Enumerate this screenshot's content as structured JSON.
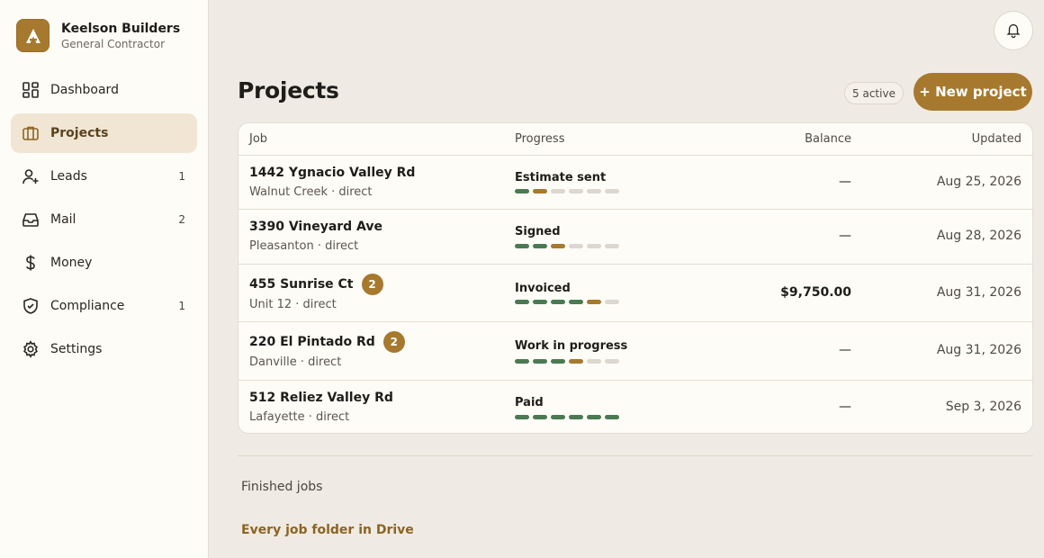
{
  "brand": {
    "name": "Keelson Builders",
    "subtitle": "General Contractor",
    "logo_letter": "A"
  },
  "nav": [
    {
      "label": "Dashboard",
      "icon": "dashboard-icon",
      "count": ""
    },
    {
      "label": "Projects",
      "icon": "briefcase-icon",
      "count": "",
      "active": true
    },
    {
      "label": "Leads",
      "icon": "user-plus-icon",
      "count": "1"
    },
    {
      "label": "Mail",
      "icon": "inbox-icon",
      "count": "2"
    },
    {
      "label": "Money",
      "icon": "dollar-icon",
      "count": ""
    },
    {
      "label": "Compliance",
      "icon": "shield-check-icon",
      "count": "1"
    },
    {
      "label": "Settings",
      "icon": "gear-icon",
      "count": ""
    }
  ],
  "header": {
    "notifications_icon": "bell-icon"
  },
  "page": {
    "title": "Projects",
    "active_label": "5 active",
    "new_button": "+ New project"
  },
  "table": {
    "columns": {
      "job": "Job",
      "progress": "Progress",
      "balance": "Balance",
      "updated": "Updated"
    },
    "progress_steps": 6,
    "rows": [
      {
        "job": "1442 Ygnacio Valley Rd",
        "location": "Walnut Creek · direct",
        "badge": "",
        "status": "Estimate sent",
        "steps_done": 1,
        "balance": "—",
        "updated": "Aug 25, 2026"
      },
      {
        "job": "3390 Vineyard Ave",
        "location": "Pleasanton · direct",
        "badge": "",
        "status": "Signed",
        "steps_done": 2,
        "balance": "—",
        "updated": "Aug 28, 2026"
      },
      {
        "job": "455 Sunrise Ct",
        "location": "Unit 12 · direct",
        "badge": "2",
        "status": "Invoiced",
        "steps_done": 4,
        "balance": "$9,750.00",
        "updated": "Aug 31, 2026"
      },
      {
        "job": "220 El Pintado Rd",
        "location": "Danville · direct",
        "badge": "2",
        "status": "Work in progress",
        "steps_done": 3,
        "balance": "—",
        "updated": "Aug 31, 2026"
      },
      {
        "job": "512 Reliez Valley Rd",
        "location": "Lafayette · direct",
        "badge": "",
        "status": "Paid",
        "steps_done": 6,
        "balance": "—",
        "updated": "Sep 3, 2026"
      }
    ]
  },
  "footer": {
    "finished_label": "Finished jobs",
    "drive_link": "Every job folder in Drive"
  },
  "colors": {
    "accent": "#a6792e",
    "done": "#4b7a52",
    "pending": "#dcd8d0",
    "active_nav_bg": "#f1e6d3"
  }
}
